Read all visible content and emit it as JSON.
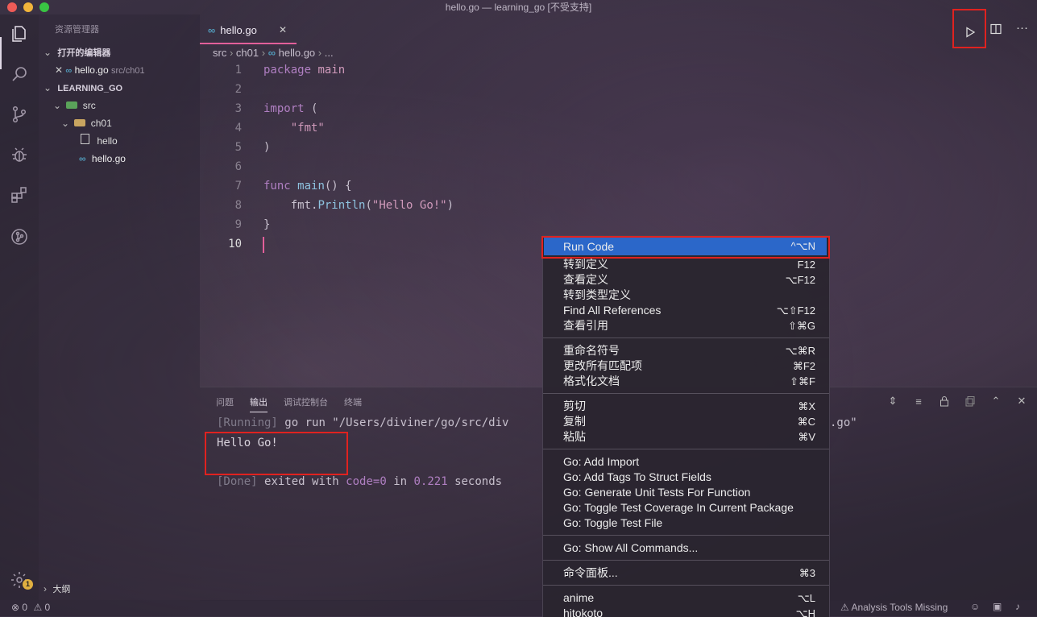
{
  "window": {
    "title": "hello.go — learning_go [不受支持]"
  },
  "sidebar": {
    "title": "资源管理器",
    "open_editors_header": "打开的编辑器",
    "open_editor": {
      "name": "hello.go",
      "path": "src/ch01"
    },
    "project_header": "LEARNING_GO",
    "tree": [
      {
        "label": "src"
      },
      {
        "label": "ch01"
      },
      {
        "label": "hello"
      },
      {
        "label": "hello.go"
      }
    ],
    "outline_label": "大纲"
  },
  "editor": {
    "tab_label": "hello.go",
    "tab_icon": "GO",
    "breadcrumb": {
      "a": "src",
      "b": "ch01",
      "c": "hello.go",
      "d": "..."
    },
    "lines": [
      {
        "num": "1"
      },
      {
        "num": "2"
      },
      {
        "num": "3"
      },
      {
        "num": "4"
      },
      {
        "num": "5"
      },
      {
        "num": "6"
      },
      {
        "num": "7"
      },
      {
        "num": "8"
      },
      {
        "num": "9"
      },
      {
        "num": "10"
      }
    ],
    "code": {
      "l1_kw": "package",
      "l1_name": "main",
      "l3_kw": "import",
      "l3_paren": "(",
      "l4_str": "\"fmt\"",
      "l5_paren": ")",
      "l7_kw": "func",
      "l7_fn": "main",
      "l7_rest": "() {",
      "l8_pkg": "fmt.",
      "l8_fn": "Println",
      "l8_open": "(",
      "l8_str": "\"Hello Go!\"",
      "l8_close": ")",
      "l9_brace": "}"
    }
  },
  "panel": {
    "tabs": [
      "问题",
      "输出",
      "调试控制台",
      "终端"
    ],
    "active_tab": "输出",
    "output": {
      "running_tag": "[Running]",
      "running_cmd": "go run \"/Users/diviner/go/src/div",
      "running_tail": ".go\"",
      "hello": "Hello Go!",
      "done_tag": "[Done]",
      "done_a": "exited with",
      "done_code": "code=0",
      "done_b": "in",
      "done_time": "0.221",
      "done_c": "seconds"
    }
  },
  "context_menu": {
    "groups": [
      [
        {
          "label": "Run Code",
          "shortcut": "^⌥N"
        },
        {
          "label": "转到定义",
          "shortcut": "F12"
        },
        {
          "label": "查看定义",
          "shortcut": "⌥F12"
        },
        {
          "label": "转到类型定义",
          "shortcut": ""
        },
        {
          "label": "Find All References",
          "shortcut": "⌥⇧F12"
        },
        {
          "label": "查看引用",
          "shortcut": "⇧⌘G"
        }
      ],
      [
        {
          "label": "重命名符号",
          "shortcut": "⌥⌘R"
        },
        {
          "label": "更改所有匹配项",
          "shortcut": "⌘F2"
        },
        {
          "label": "格式化文档",
          "shortcut": "⇧⌘F"
        }
      ],
      [
        {
          "label": "剪切",
          "shortcut": "⌘X"
        },
        {
          "label": "复制",
          "shortcut": "⌘C"
        },
        {
          "label": "粘贴",
          "shortcut": "⌘V"
        }
      ],
      [
        {
          "label": "Go: Add Import",
          "shortcut": ""
        },
        {
          "label": "Go: Add Tags To Struct Fields",
          "shortcut": ""
        },
        {
          "label": "Go: Generate Unit Tests For Function",
          "shortcut": ""
        },
        {
          "label": "Go: Toggle Test Coverage In Current Package",
          "shortcut": ""
        },
        {
          "label": "Go: Toggle Test File",
          "shortcut": ""
        }
      ],
      [
        {
          "label": "Go: Show All Commands...",
          "shortcut": ""
        }
      ],
      [
        {
          "label": "命令面板...",
          "shortcut": "⌘3"
        }
      ],
      [
        {
          "label": "anime",
          "shortcut": "⌥L"
        },
        {
          "label": "hitokoto",
          "shortcut": "⌥H"
        }
      ]
    ]
  },
  "statusbar": {
    "errors": "0",
    "warnings": "0",
    "analysis": "Analysis Tools Missing",
    "settings_badge": "1"
  },
  "colors": {
    "accent_pink": "#e25f9a",
    "menu_highlight": "#2b67c9",
    "annotation_red": "#e0221f",
    "go_icon": "#519aba"
  }
}
